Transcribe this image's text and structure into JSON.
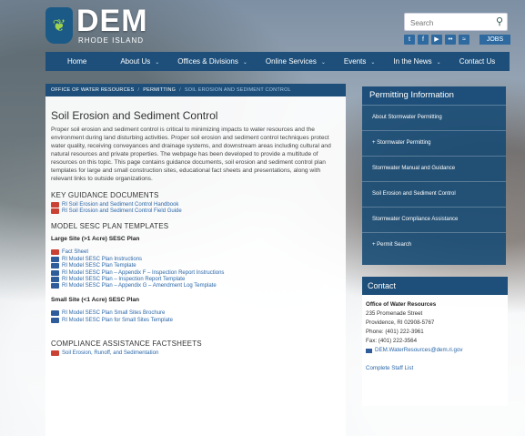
{
  "header": {
    "brand": "DEM",
    "brand_sub": "RHODE ISLAND",
    "search_placeholder": "Search",
    "jobs_label": "JOBS"
  },
  "nav": {
    "items": [
      "Home",
      "About Us",
      "Offices & Divisions",
      "Online Services",
      "Events",
      "In the News",
      "Contact Us"
    ]
  },
  "breadcrumb": {
    "items": [
      "OFFICE OF WATER RESOURCES",
      "PERMITTING",
      "SOIL EROSION AND SEDIMENT CONTROL"
    ]
  },
  "main": {
    "title": "Soil Erosion and Sediment Control",
    "intro": "Proper soil erosion and sediment control is critical to minimizing impacts to water resources and the environment during land disturbing activities. Proper soil erosion and sediment control techniques protect water quality, receiving conveyances and drainage systems, and downstream areas including cultural and natural resources and private properties. The webpage has been developed to provide a multitude of resources on this topic. This page contains guidance documents, soil erosion and sediment control plan templates for large and small construction sites, educational fact sheets and presentations, along with relevant links to outside organizations.",
    "guidance_heading": "KEY GUIDANCE DOCUMENTS",
    "guidance_links": [
      "RI Soil Erosion and Sediment Control Handbook",
      "RI Soil Erosion and Sediment Control Field Guide"
    ],
    "templates_heading": "MODEL SESC PLAN TEMPLATES",
    "large_heading": "Large Site (>1 Acre) SESC Plan",
    "large_links": [
      "Fact Sheet",
      "RI Model SESC Plan Instructions",
      "RI Model SESC Plan Template",
      "RI Model SESC Plan – Appendix F – Inspection Report Instructions",
      "RI Model SESC Plan – Inspection Report Template",
      "RI Model SESC Plan – Appendix G – Amendment Log Template"
    ],
    "small_heading": "Small Site (<1 Acre) SESC Plan",
    "small_links": [
      "RI Model SESC Plan Small Sites Brochure",
      "RI Model SESC Plan for Small Sites Template"
    ],
    "compliance_heading": "COMPLIANCE ASSISTANCE FACTSHEETS",
    "compliance_links": [
      "Soil Erosion, Runoff, and Sedimentation"
    ]
  },
  "permitting": {
    "title": "Permitting Information",
    "items": [
      "About Stormwater Permitting",
      "+ Stormwater Permitting",
      "Stormwater Manual and Guidance",
      "Soil Erosion and Sediment Control",
      "Stormwater Compliance Assistance",
      "+ Permit Search"
    ]
  },
  "contact": {
    "title": "Contact",
    "office": "Office of Water Resources",
    "street": "235 Promenade Street",
    "city": "Providence, RI 02908-5767",
    "phone": "Phone: (401) 222-3961",
    "fax": "Fax: (401) 222-3564",
    "email": "DEM.WaterResources@dem.ri.gov",
    "staff_link": "Complete Staff List"
  },
  "colors": {
    "navy": "#1d4f7a",
    "link": "#2a67a8",
    "pdf": "#c94234",
    "word": "#2f5d9b"
  }
}
